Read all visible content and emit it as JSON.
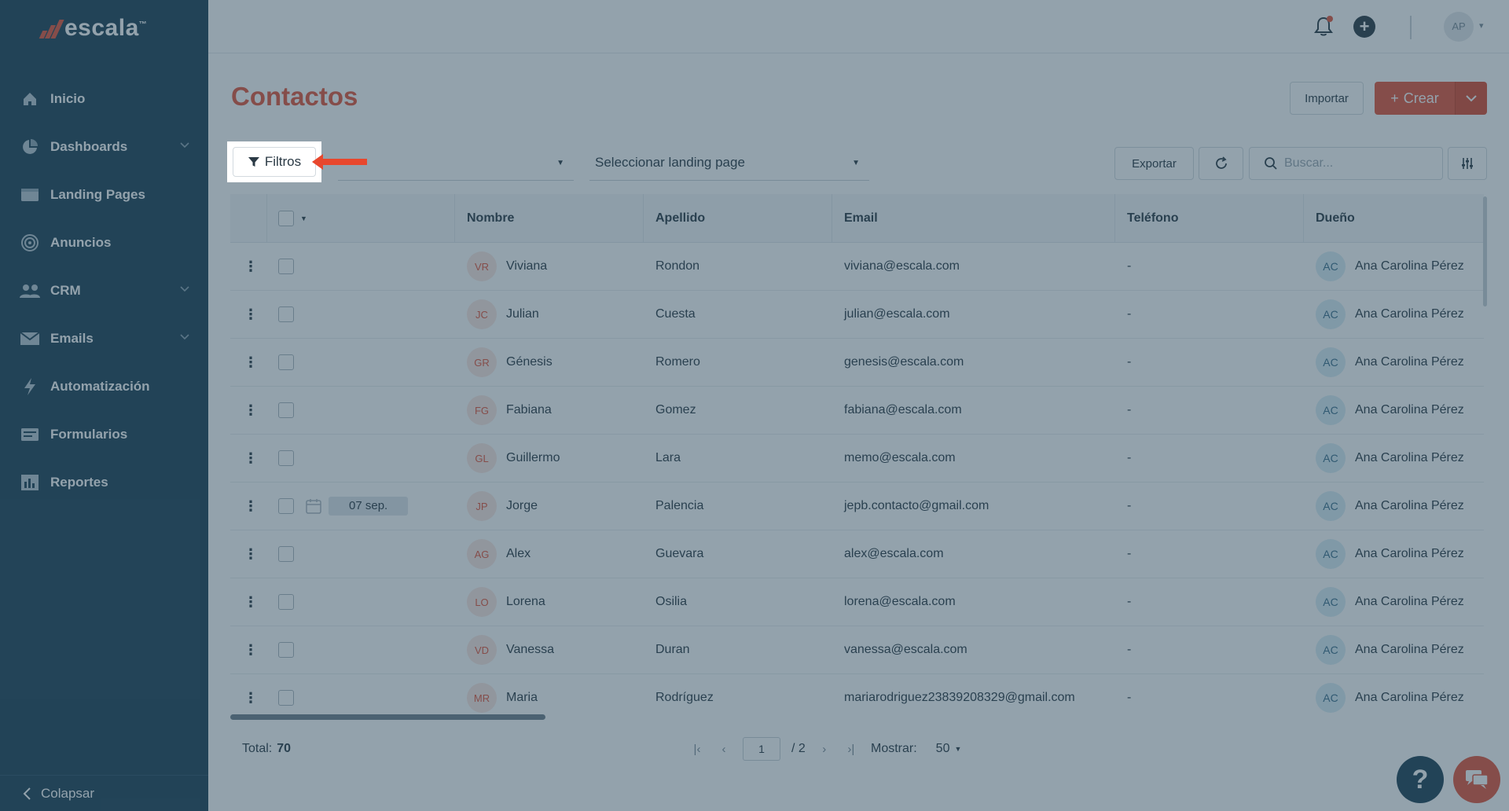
{
  "brand": {
    "name": "escala",
    "tm": "™"
  },
  "sidebar": {
    "items": [
      {
        "label": "Inicio",
        "icon": "home-icon",
        "has_chevron": false
      },
      {
        "label": "Dashboards",
        "icon": "pie-chart-icon",
        "has_chevron": true
      },
      {
        "label": "Landing Pages",
        "icon": "browser-window-icon",
        "has_chevron": false
      },
      {
        "label": "Anuncios",
        "icon": "target-icon",
        "has_chevron": false
      },
      {
        "label": "CRM",
        "icon": "users-icon",
        "has_chevron": true
      },
      {
        "label": "Emails",
        "icon": "envelope-icon",
        "has_chevron": true
      },
      {
        "label": "Automatización",
        "icon": "lightning-icon",
        "has_chevron": false
      },
      {
        "label": "Formularios",
        "icon": "form-icon",
        "has_chevron": false
      },
      {
        "label": "Reportes",
        "icon": "bar-report-icon",
        "has_chevron": false
      }
    ],
    "collapse_label": "Colapsar"
  },
  "topbar": {
    "avatar_initials": "AP"
  },
  "header": {
    "title": "Contactos",
    "import_label": "Importar",
    "create_label": "Crear",
    "create_plus": "+"
  },
  "filters": {
    "filters_label": "Filtros",
    "select1_value": "",
    "select2_value": "Seleccionar landing page",
    "export_label": "Exportar",
    "search_placeholder": "Buscar..."
  },
  "table": {
    "columns": [
      "Nombre",
      "Apellido",
      "Email",
      "Teléfono",
      "Dueño"
    ],
    "rows": [
      {
        "initials": "VR",
        "first": "Viviana",
        "last": "Rondon",
        "email": "viviana@escala.com",
        "phone": "-",
        "owner_initials": "AC",
        "owner": "Ana Carolina Pérez",
        "date": ""
      },
      {
        "initials": "JC",
        "first": "Julian",
        "last": "Cuesta",
        "email": "julian@escala.com",
        "phone": "-",
        "owner_initials": "AC",
        "owner": "Ana Carolina Pérez",
        "date": ""
      },
      {
        "initials": "GR",
        "first": "Génesis",
        "last": "Romero",
        "email": "genesis@escala.com",
        "phone": "-",
        "owner_initials": "AC",
        "owner": "Ana Carolina Pérez",
        "date": ""
      },
      {
        "initials": "FG",
        "first": "Fabiana",
        "last": "Gomez",
        "email": "fabiana@escala.com",
        "phone": "-",
        "owner_initials": "AC",
        "owner": "Ana Carolina Pérez",
        "date": ""
      },
      {
        "initials": "GL",
        "first": "Guillermo",
        "last": "Lara",
        "email": "memo@escala.com",
        "phone": "-",
        "owner_initials": "AC",
        "owner": "Ana Carolina Pérez",
        "date": ""
      },
      {
        "initials": "JP",
        "first": "Jorge",
        "last": "Palencia",
        "email": "jepb.contacto@gmail.com",
        "phone": "-",
        "owner_initials": "AC",
        "owner": "Ana Carolina Pérez",
        "date": "07 sep."
      },
      {
        "initials": "AG",
        "first": "Alex",
        "last": "Guevara",
        "email": "alex@escala.com",
        "phone": "-",
        "owner_initials": "AC",
        "owner": "Ana Carolina Pérez",
        "date": ""
      },
      {
        "initials": "LO",
        "first": "Lorena",
        "last": "Osilia",
        "email": "lorena@escala.com",
        "phone": "-",
        "owner_initials": "AC",
        "owner": "Ana Carolina Pérez",
        "date": ""
      },
      {
        "initials": "VD",
        "first": "Vanessa",
        "last": "Duran",
        "email": "vanessa@escala.com",
        "phone": "-",
        "owner_initials": "AC",
        "owner": "Ana Carolina Pérez",
        "date": ""
      },
      {
        "initials": "MR",
        "first": "Maria",
        "last": "Rodríguez",
        "email": "mariarodriguez23839208329@gmail.com",
        "phone": "-",
        "owner_initials": "AC",
        "owner": "Ana Carolina Pérez",
        "date": ""
      }
    ]
  },
  "footer": {
    "total_label": "Total:",
    "total_value": "70",
    "page_current": "1",
    "page_total": "/ 2",
    "show_label": "Mostrar:",
    "show_value": "50"
  },
  "colors": {
    "brand_red": "#e2553b",
    "sidebar_bg": "#1d4155",
    "overlay": "rgba(40,70,90,0.5)"
  }
}
